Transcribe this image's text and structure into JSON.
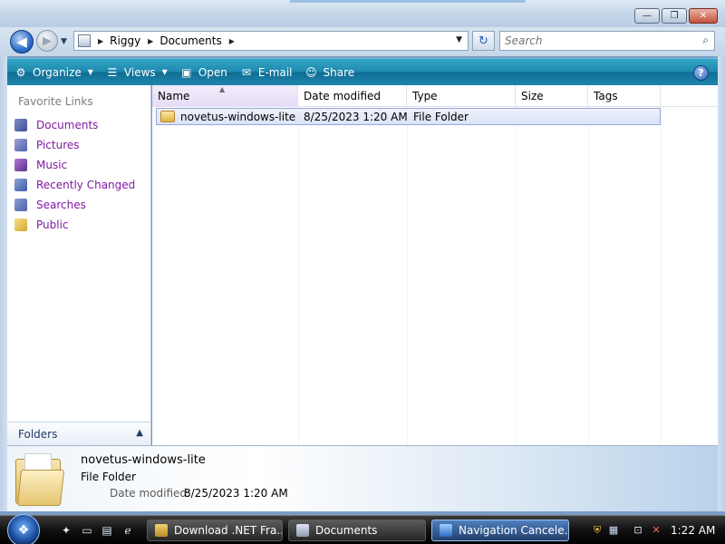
{
  "window": {
    "controls": {
      "minimize": "—",
      "maximize": "❐",
      "close": "✕"
    }
  },
  "address": {
    "back_icon": "back-arrow-icon",
    "forward_icon": "forward-arrow-icon",
    "crumbs": [
      "Riggy",
      "Documents"
    ],
    "refresh_icon": "refresh-icon"
  },
  "search": {
    "placeholder": "Search"
  },
  "toolbar": {
    "organize": "Organize",
    "views": "Views",
    "open": "Open",
    "email": "E-mail",
    "share": "Share",
    "help": "?"
  },
  "navpane": {
    "title": "Favorite Links",
    "items": [
      "Documents",
      "Pictures",
      "Music",
      "Recently Changed",
      "Searches",
      "Public"
    ],
    "folders_label": "Folders"
  },
  "columns": {
    "name": "Name",
    "date": "Date modified",
    "type": "Type",
    "size": "Size",
    "tags": "Tags"
  },
  "files": [
    {
      "name": "novetus-windows-lite",
      "date": "8/25/2023 1:20 AM",
      "type": "File Folder",
      "size": "",
      "tags": ""
    }
  ],
  "details": {
    "name": "novetus-windows-lite",
    "type": "File Folder",
    "date_label": "Date modified:",
    "date_value": "8/25/2023 1:20 AM"
  },
  "taskbar": {
    "tasks": [
      "Download .NET Fra...",
      "Documents",
      "Navigation Cancele..."
    ],
    "clock": "1:22 AM"
  },
  "colors": {
    "toolbar": "#1d87ad",
    "link": "#7e1aa3",
    "selection": "#dce3f7"
  }
}
